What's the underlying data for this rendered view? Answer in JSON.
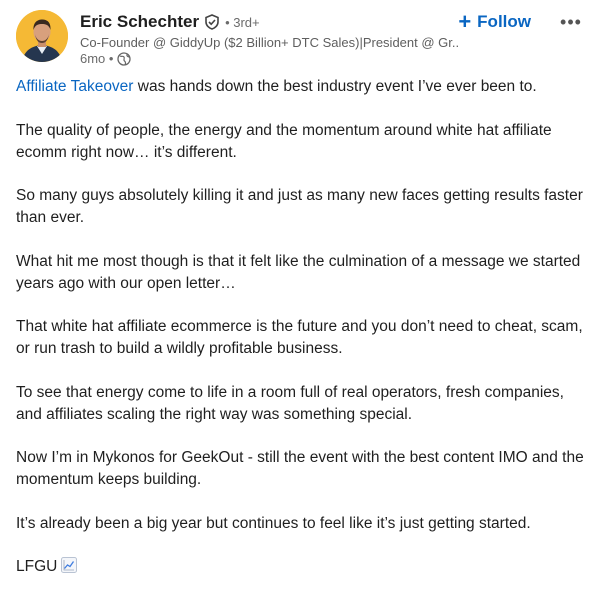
{
  "author": {
    "name": "Eric Schechter",
    "degree": "• 3rd+",
    "headline": "Co-Founder @ GiddyUp ($2 Billion+ DTC Sales)|President @ Gr...",
    "time": "6mo •"
  },
  "actions": {
    "follow_label": "Follow",
    "more_label": "•••"
  },
  "post": {
    "p1_link": "Affiliate Takeover",
    "p1_rest": " was hands down the best industry event I’ve ever been to.",
    "p2": "The quality of people, the energy and the momentum around white hat affiliate ecomm right now… it’s different.",
    "p3": "So many guys absolutely killing it and just as many new faces getting results faster than ever.",
    "p4": "What hit me most though is that it felt like the culmination of a message we started years ago with our open letter…",
    "p5": "That white hat affiliate ecommerce is the future and you don’t need to cheat, scam, or run trash to build a wildly profitable business.",
    "p6": "To see that energy come to life in a room full of real operators, fresh companies, and affiliates scaling the right way was something special.",
    "p7": "Now I’m in Mykonos for GeekOut - still the event with the best content IMO and the momentum keeps building.",
    "p8": "It’s already been a big year but continues to feel like it’s just getting started.",
    "p9": "LFGU"
  },
  "icons": {
    "verified": "verified-shield-icon",
    "globe": "globe-icon",
    "chart_emoji": "chart-increasing-icon"
  },
  "colors": {
    "accent": "#0a66c2",
    "avatar_bg": "#f5b935"
  }
}
